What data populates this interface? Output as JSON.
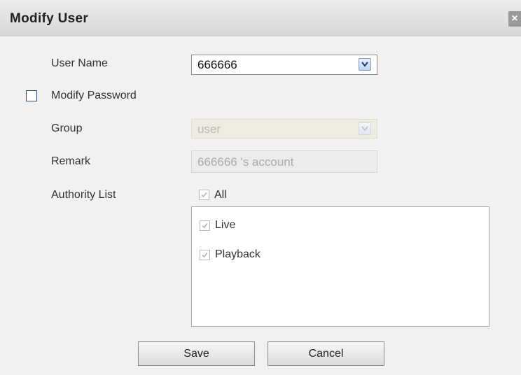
{
  "dialog": {
    "title": "Modify User",
    "close_icon": "close-icon"
  },
  "form": {
    "user_name": {
      "label": "User Name",
      "value": "666666"
    },
    "modify_password": {
      "label": "Modify Password",
      "checked": false
    },
    "group": {
      "label": "Group",
      "value": "user",
      "disabled": true
    },
    "remark": {
      "label": "Remark",
      "value": "666666 's account",
      "disabled": true
    },
    "authority": {
      "label": "Authority List",
      "all_label": "All",
      "all_checked": true,
      "items": [
        {
          "label": "Live",
          "checked": true
        },
        {
          "label": "Playback",
          "checked": true
        }
      ]
    }
  },
  "buttons": {
    "save_label": "Save",
    "cancel_label": "Cancel"
  },
  "colors": {
    "dialog_bg": "#f1f1f1",
    "title_bar": "#d8d8d8",
    "disabled_field": "#eeebe0",
    "checkbox_border": "#2a4d7a"
  }
}
